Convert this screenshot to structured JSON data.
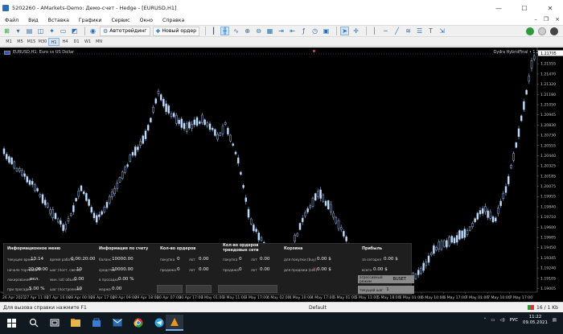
{
  "window": {
    "title": "5202260 - AMarkets-Demo: Демо-счет - Hedge - [EURUSD,H1]",
    "minimize": "—",
    "maximize": "☐",
    "close": "✕"
  },
  "menu": [
    "Файл",
    "Вид",
    "Вставка",
    "Графики",
    "Сервис",
    "Окно",
    "Справка"
  ],
  "toolbar": {
    "autotrading_label": "Автотрейдинг",
    "new_order_label": "Новый ордер"
  },
  "timeframes": [
    "M1",
    "M5",
    "M15",
    "M30",
    "H1",
    "H4",
    "D1",
    "W1",
    "MN"
  ],
  "active_timeframe": "H1",
  "chart": {
    "header": "EURUSD,H1:  Euro vs US Dollar",
    "indicator": "Gydra HybridFinal • 1.2",
    "current_price": "1.21705",
    "price_labels": [
      "1.21705",
      "1.21555",
      "1.21470",
      "1.21320",
      "1.21180",
      "1.21050",
      "1.20945",
      "1.20830",
      "1.20730",
      "1.20555",
      "1.20440",
      "1.20325",
      "1.20185",
      "1.20075",
      "1.19955",
      "1.19840",
      "1.19710",
      "1.19600",
      "1.19605",
      "1.19450",
      "1.19345",
      "1.19240",
      "1.19105",
      "1.19005"
    ],
    "time_labels": [
      "26 Apr 2021",
      "27 Apr 11:00",
      "27 Apr 16:00",
      "28 Apr 00:00",
      "28 Apr 17:00",
      "29 Apr 09:00",
      "29 Apr 18:00",
      "30 Apr 07:00",
      "30 Apr 17:00",
      "3 May 01:00",
      "3 May 11:00",
      "3 May 17:00",
      "4 May 02:00",
      "4 May 10:00",
      "4 May 17:00",
      "5 May 01:00",
      "5 May 11:00",
      "5 May 18:00",
      "6 May 01:00",
      "6 May 10:00",
      "6 May 17:00",
      "7 May 01:00",
      "7 May 10:00",
      "7 May 17:00"
    ]
  },
  "panel": {
    "info": {
      "title": "Информационное меню",
      "server_time_label": "текущее время",
      "server_time": "13:14",
      "working_time_label": "время работы",
      "working_time": "0 00:20:00",
      "start_time_label": "начало торговли",
      "start_time": "20:00",
      "end_time": "6:00",
      "spread_label": "шаг (пост. свечи)",
      "spread": "10",
      "trading_label": "локирование",
      "trading": "вкл.",
      "lots_label": "мин. lot/ объем",
      "lots": "0.00",
      "profit_pct_label": "при просадке",
      "profit_pct": "5.00 %",
      "step_label": "шаг (построение)",
      "step": "10"
    },
    "account": {
      "title": "Информация по счету",
      "balance_label": "баланс",
      "balance": "10000.00",
      "equity_label": "средства",
      "equity": "10000.00",
      "drawdown_label": "в просадке",
      "drawdown": "0.00 %",
      "margin_label": "маржа",
      "margin": "0.00"
    },
    "orders": {
      "title": "Кол-во ордеров",
      "buy_label": "покупка",
      "buy": "0",
      "buy_lot_label": "лот",
      "buy_lot": "0.00",
      "sell_label": "продажа",
      "sell": "0",
      "sell_lot_label": "лот",
      "sell_lot": "0.00"
    },
    "grid": {
      "title": "Кол-во ордеров трендовые сети",
      "buy_label": "покупка",
      "buy": "0",
      "buy_lot_label": "лот",
      "buy_lot": "0.00",
      "sell_label": "продажа",
      "sell": "0",
      "sell_lot_label": "лот",
      "sell_lot": "0.00"
    },
    "basket": {
      "title": "Корзина",
      "buy_label": "для покупки (buy)",
      "buy": "0.00 $",
      "sell_label": "для продажи (sell)",
      "sell": "0.00 $"
    },
    "profit": {
      "title": "Прибыль",
      "today_label": "за сегодня",
      "today": "0.00 $",
      "total_label": "всего",
      "total": "0.00 $",
      "mode_label": "агрессивный режим",
      "mode": "BUSET",
      "step_label": "текущий шаг",
      "step": "1"
    }
  },
  "statusbar": {
    "help": "Для вызова справки нажмите F1",
    "profile": "Default",
    "traffic": "16 / 1 Kb"
  },
  "taskbar": {
    "lang": "РУС",
    "time": "11:22",
    "date": "09.05.2021"
  }
}
